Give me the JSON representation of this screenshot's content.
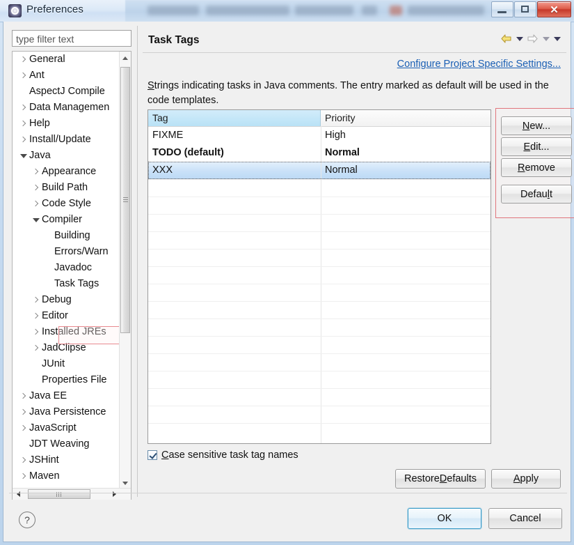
{
  "window": {
    "title": "Preferences",
    "icon": "preferences-gear-icon",
    "controls": {
      "minimize": "minimize-icon",
      "maximize": "maximize-icon",
      "close": "✕"
    }
  },
  "sidebar": {
    "filter": {
      "placeholder": "type filter text",
      "value": ""
    },
    "items": [
      {
        "label": "General",
        "indent": 0,
        "twisty": "collapsed"
      },
      {
        "label": "Ant",
        "indent": 0,
        "twisty": "collapsed"
      },
      {
        "label": "AspectJ Compile",
        "indent": 0,
        "twisty": "none"
      },
      {
        "label": "Data Managemen",
        "indent": 0,
        "twisty": "collapsed"
      },
      {
        "label": "Help",
        "indent": 0,
        "twisty": "collapsed"
      },
      {
        "label": "Install/Update",
        "indent": 0,
        "twisty": "collapsed"
      },
      {
        "label": "Java",
        "indent": 0,
        "twisty": "expanded"
      },
      {
        "label": "Appearance",
        "indent": 1,
        "twisty": "collapsed"
      },
      {
        "label": "Build Path",
        "indent": 1,
        "twisty": "collapsed"
      },
      {
        "label": "Code Style",
        "indent": 1,
        "twisty": "collapsed"
      },
      {
        "label": "Compiler",
        "indent": 1,
        "twisty": "expanded"
      },
      {
        "label": "Building",
        "indent": 2,
        "twisty": "none"
      },
      {
        "label": "Errors/Warn",
        "indent": 2,
        "twisty": "none"
      },
      {
        "label": "Javadoc",
        "indent": 2,
        "twisty": "none"
      },
      {
        "label": "Task Tags",
        "indent": 2,
        "twisty": "none",
        "selected": true
      },
      {
        "label": "Debug",
        "indent": 1,
        "twisty": "collapsed"
      },
      {
        "label": "Editor",
        "indent": 1,
        "twisty": "collapsed"
      },
      {
        "label": "Installed JREs",
        "indent": 1,
        "twisty": "collapsed"
      },
      {
        "label": "JadClipse",
        "indent": 1,
        "twisty": "collapsed"
      },
      {
        "label": "JUnit",
        "indent": 1,
        "twisty": "none"
      },
      {
        "label": "Properties File",
        "indent": 1,
        "twisty": "none"
      },
      {
        "label": "Java EE",
        "indent": 0,
        "twisty": "collapsed"
      },
      {
        "label": "Java Persistence",
        "indent": 0,
        "twisty": "collapsed"
      },
      {
        "label": "JavaScript",
        "indent": 0,
        "twisty": "collapsed"
      },
      {
        "label": "JDT Weaving",
        "indent": 0,
        "twisty": "none"
      },
      {
        "label": "JSHint",
        "indent": 0,
        "twisty": "collapsed"
      },
      {
        "label": "Maven",
        "indent": 0,
        "twisty": "collapsed"
      }
    ]
  },
  "page": {
    "title": "Task Tags",
    "nav": {
      "back": "back-arrow-icon",
      "back_menu": "chevron-down-icon",
      "forward": "forward-arrow-icon",
      "forward_menu": "chevron-down-icon",
      "view_menu": "chevron-down-icon"
    },
    "configure_link": "Configure Project Specific Settings...",
    "description_mnemonic": "S",
    "description_rest": "trings indicating tasks in Java comments. The entry marked as default will be used in the code templates."
  },
  "table": {
    "columns": [
      "Tag",
      "Priority"
    ],
    "rows": [
      {
        "tag": "FIXME",
        "priority": "High",
        "bold": false,
        "selected": false
      },
      {
        "tag": "TODO (default)",
        "priority": "Normal",
        "bold": true,
        "selected": false
      },
      {
        "tag": "XXX",
        "priority": "Normal",
        "bold": false,
        "selected": true
      }
    ]
  },
  "side_buttons": [
    {
      "pre": "",
      "mnemonic": "N",
      "post": "ew..."
    },
    {
      "pre": "",
      "mnemonic": "E",
      "post": "dit..."
    },
    {
      "pre": "",
      "mnemonic": "R",
      "post": "emove"
    },
    {
      "pre": "Defau",
      "mnemonic": "l",
      "post": "t"
    }
  ],
  "options": {
    "case_sensitive": {
      "checked": true,
      "pre": "",
      "mnemonic": "C",
      "post": "ase sensitive task tag names"
    }
  },
  "page_buttons": [
    {
      "pre": "Restore ",
      "mnemonic": "D",
      "post": "efaults"
    },
    {
      "pre": "",
      "mnemonic": "A",
      "post": "pply"
    }
  ],
  "footer": {
    "help": "?",
    "ok": "OK",
    "cancel": "Cancel"
  },
  "colors": {
    "accent": "#1a5fb4",
    "header_highlight": "#b9e2f6",
    "selection": "#c9e1f8",
    "annotation": "#e0757c",
    "close_button": "#c6392a"
  }
}
